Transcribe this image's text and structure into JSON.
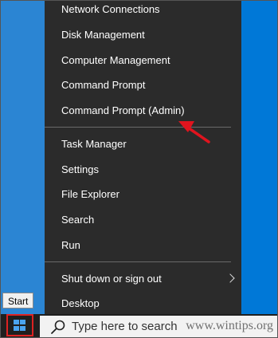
{
  "menu": {
    "group1": [
      {
        "label": "Network Connections"
      },
      {
        "label": "Disk Management"
      },
      {
        "label": "Computer Management"
      },
      {
        "label": "Command Prompt"
      },
      {
        "label": "Command Prompt (Admin)"
      }
    ],
    "group2": [
      {
        "label": "Task Manager"
      },
      {
        "label": "Settings"
      },
      {
        "label": "File Explorer"
      },
      {
        "label": "Search"
      },
      {
        "label": "Run"
      }
    ],
    "group3": [
      {
        "label": "Shut down or sign out"
      },
      {
        "label": "Desktop"
      }
    ]
  },
  "tooltip": {
    "text": "Start"
  },
  "taskbar": {
    "search_placeholder": "Type here to search",
    "watermark": "www.wintips.org"
  },
  "colors": {
    "menu_bg": "#2b2b2b",
    "desktop": "#0078d7",
    "highlight_arrow": "#e0141e",
    "start_outline": "#dd2222"
  },
  "icons": [
    "windows-logo-icon",
    "search-icon",
    "chevron-right-icon",
    "red-arrow-icon"
  ]
}
